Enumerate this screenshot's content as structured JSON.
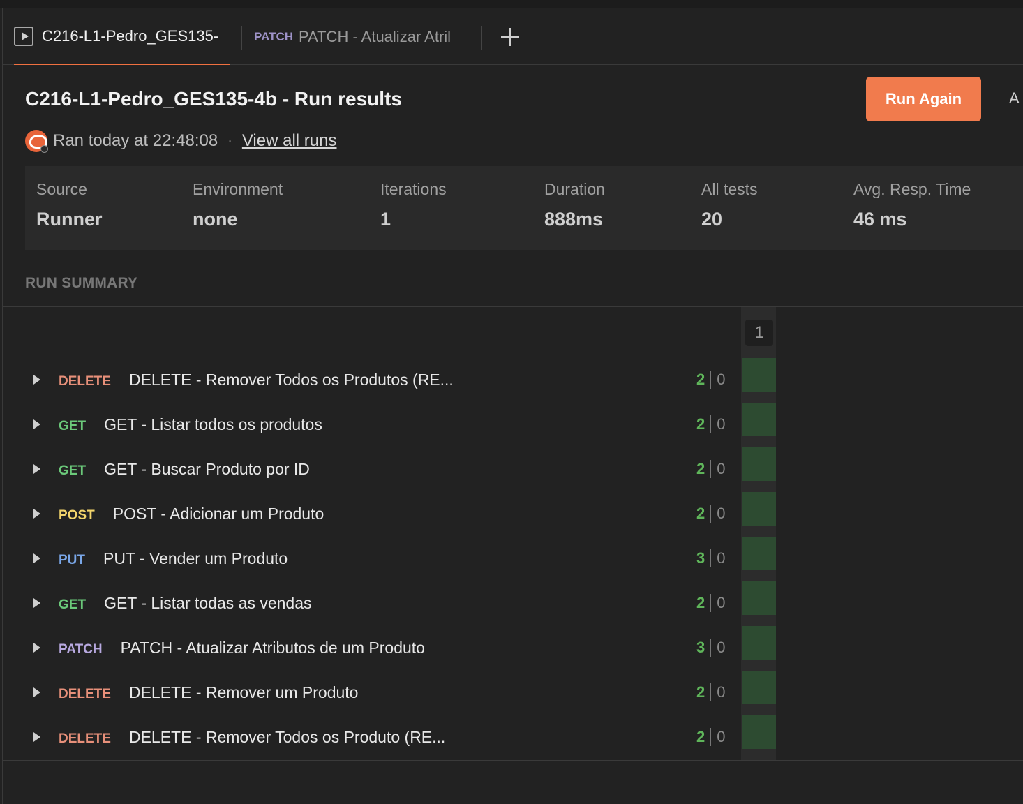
{
  "tabs": [
    {
      "label": "C216-L1-Pedro_GES135-",
      "method": "",
      "active": true
    },
    {
      "label": "PATCH - Atualizar Atril",
      "method": "PATCH",
      "active": false
    }
  ],
  "header": {
    "title": "C216-L1-Pedro_GES135-4b - Run results",
    "run_again_label": "Run Again",
    "clipped_next_button": "A",
    "ran_at": "Ran today at 22:48:08",
    "separator": "·",
    "view_all_runs": "View all runs"
  },
  "stats": [
    {
      "label": "Source",
      "value": "Runner"
    },
    {
      "label": "Environment",
      "value": "none"
    },
    {
      "label": "Iterations",
      "value": "1"
    },
    {
      "label": "Duration",
      "value": "888ms"
    },
    {
      "label": "All tests",
      "value": "20"
    },
    {
      "label": "Avg. Resp. Time",
      "value": "46 ms"
    }
  ],
  "summary": {
    "label": "RUN SUMMARY",
    "iteration_header": "1",
    "rows": [
      {
        "method": "DELETE",
        "name": "DELETE - Remover Todos os Produtos (RE...",
        "passed": "2",
        "failed": "0"
      },
      {
        "method": "GET",
        "name": "GET - Listar todos os produtos",
        "passed": "2",
        "failed": "0"
      },
      {
        "method": "GET",
        "name": "GET - Buscar Produto por ID",
        "passed": "2",
        "failed": "0"
      },
      {
        "method": "POST",
        "name": "POST - Adicionar um Produto",
        "passed": "2",
        "failed": "0"
      },
      {
        "method": "PUT",
        "name": "PUT - Vender um Produto",
        "passed": "3",
        "failed": "0"
      },
      {
        "method": "GET",
        "name": "GET - Listar todas as vendas",
        "passed": "2",
        "failed": "0"
      },
      {
        "method": "PATCH",
        "name": "PATCH - Atualizar Atributos de um Produto",
        "passed": "3",
        "failed": "0"
      },
      {
        "method": "DELETE",
        "name": "DELETE - Remover um Produto",
        "passed": "2",
        "failed": "0"
      },
      {
        "method": "DELETE",
        "name": "DELETE - Remover Todos os Produto (RE...",
        "passed": "2",
        "failed": "0"
      }
    ]
  },
  "colors": {
    "accent": "#f17b4d",
    "DELETE": "#e8907a",
    "GET": "#6bc97a",
    "POST": "#f2d46b",
    "PUT": "#7aa7e8",
    "PATCH": "#b8a9e0",
    "pass": "#5fb55a",
    "cell_pass": "#2d4b31"
  }
}
